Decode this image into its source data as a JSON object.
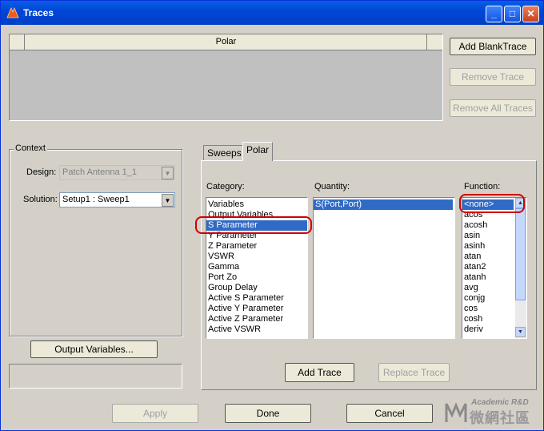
{
  "window": {
    "title": "Traces"
  },
  "traces_table": {
    "column_header": "Polar"
  },
  "buttons": {
    "add_blank_trace": "Add BlankTrace",
    "remove_trace": "Remove Trace",
    "remove_all_traces": "Remove All Traces",
    "output_variables": "Output Variables...",
    "add_trace": "Add Trace",
    "replace_trace": "Replace Trace",
    "apply": "Apply",
    "done": "Done",
    "cancel": "Cancel"
  },
  "context": {
    "legend": "Context",
    "design_label": "Design:",
    "design_value": "Patch Antenna 1_1",
    "solution_label": "Solution:",
    "solution_value": "Setup1 : Sweep1"
  },
  "tabs": [
    "Sweeps",
    "Polar"
  ],
  "category": {
    "label": "Category:",
    "items": [
      "Variables",
      "Output Variables",
      "S Parameter",
      "Y Parameter",
      "Z Parameter",
      "VSWR",
      "Gamma",
      "Port Zo",
      "Group Delay",
      "Active S Parameter",
      "Active Y Parameter",
      "Active Z Parameter",
      "Active VSWR"
    ],
    "selected": "S Parameter"
  },
  "quantity": {
    "label": "Quantity:",
    "items": [
      "S(Port,Port)"
    ]
  },
  "function": {
    "label": "Function:",
    "items": [
      "<none>",
      "acos",
      "acosh",
      "asin",
      "asinh",
      "atan",
      "atan2",
      "atanh",
      "avg",
      "conjg",
      "cos",
      "cosh",
      "deriv"
    ]
  },
  "watermark": {
    "line1": "Academic R&D",
    "line2": "微網社區"
  }
}
